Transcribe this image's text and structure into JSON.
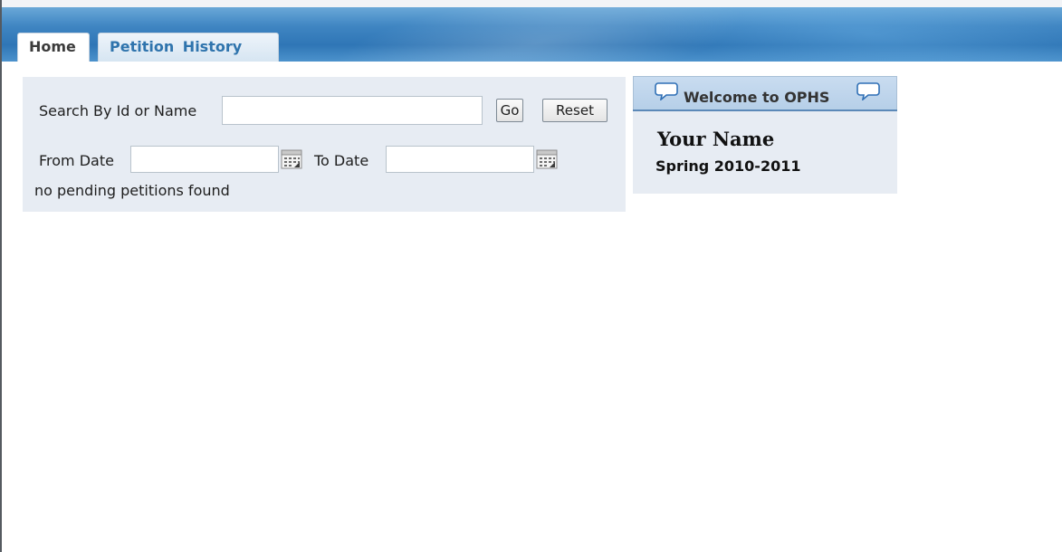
{
  "tabs": [
    {
      "label": "Home",
      "active": true
    },
    {
      "label": "Petition History",
      "active": false
    }
  ],
  "search": {
    "id_name_label": "Search By Id or Name",
    "id_name_value": "",
    "go_label": "Go",
    "reset_label": "Reset",
    "from_date_label": "From Date",
    "from_date_value": "",
    "to_date_label": "To Date",
    "to_date_value": "",
    "status_message": "no pending petitions found"
  },
  "welcome": {
    "title": "Welcome to OPHS",
    "user_name": "Your Name",
    "term": "Spring 2010-2011"
  },
  "icons": {
    "calendar": "calendar-icon",
    "speech_bubble": "speech-bubble-icon"
  },
  "colors": {
    "header_blue": "#2f76b6",
    "panel_bg": "#e7ecf3",
    "tab_text_blue": "#2f74ad"
  }
}
